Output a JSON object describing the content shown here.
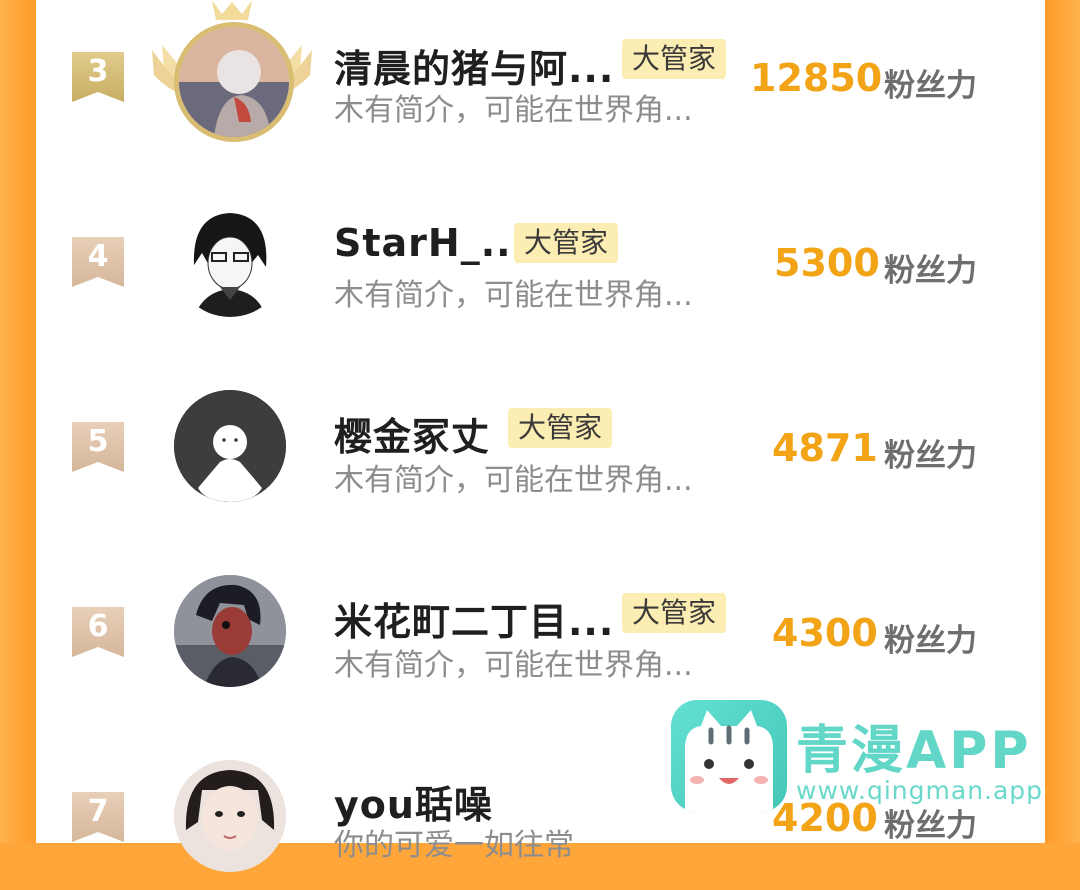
{
  "colors": {
    "frame": "#ffa63a",
    "score": "#f3a316",
    "badge_bg": "#fcedb3",
    "intro": "#8d8d8d",
    "watermark": "#62d7c8"
  },
  "rows": [
    {
      "rank": "3",
      "name": "清晨的猪与阿...",
      "badge": "大管家",
      "intro": "木有简介，可能在世界角...",
      "score": "12850",
      "unit": "粉丝力"
    },
    {
      "rank": "4",
      "name": "StarH_...",
      "badge": "大管家",
      "intro": "木有简介，可能在世界角...",
      "score": "5300",
      "unit": "粉丝力"
    },
    {
      "rank": "5",
      "name": "樱金冢丈",
      "badge": "大管家",
      "intro": "木有简介，可能在世界角...",
      "score": "4871",
      "unit": "粉丝力"
    },
    {
      "rank": "6",
      "name": "米花町二丁目...",
      "badge": "大管家",
      "intro": "木有简介，可能在世界角...",
      "score": "4300",
      "unit": "粉丝力"
    },
    {
      "rank": "7",
      "name": "you聒噪",
      "intro": "你的可爱一如往常",
      "score": "4200",
      "unit": "粉丝力"
    }
  ],
  "watermark": {
    "title": "青漫APP",
    "url": "www.qingman.app"
  }
}
